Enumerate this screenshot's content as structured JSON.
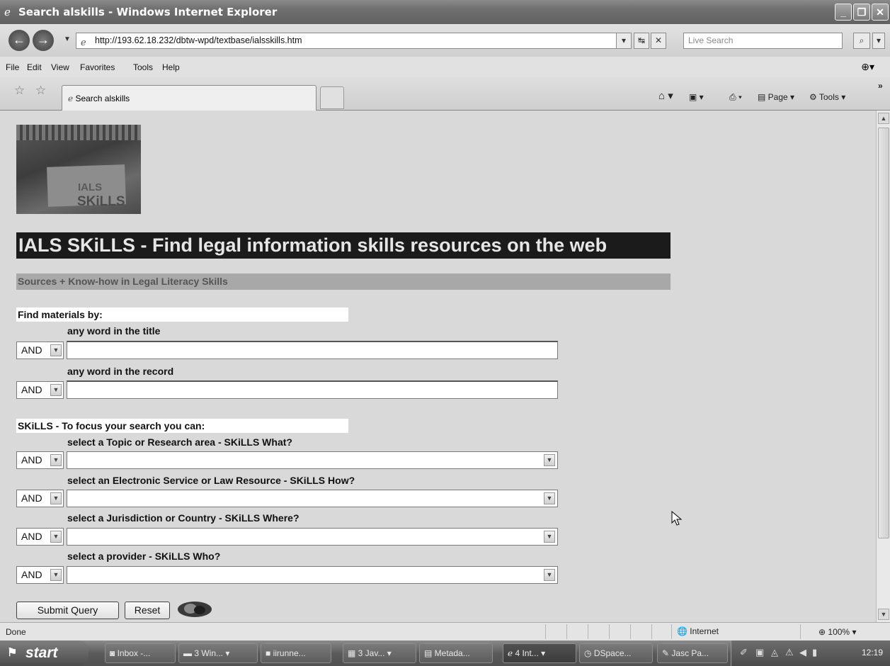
{
  "window": {
    "title": "Search alskills - Windows Internet Explorer"
  },
  "address": {
    "url": "http://193.62.18.232/dbtw-wpd/textbase/ialsskills.htm",
    "search_placeholder": "Live Search"
  },
  "menu": [
    "File",
    "Edit",
    "View",
    "Favorites",
    "Tools",
    "Help"
  ],
  "tab": {
    "label": "Search alskills"
  },
  "commandbar": {
    "page_label": "Page",
    "tools_label": "Tools"
  },
  "page": {
    "logo_line1": "IALS",
    "logo_line2": "SKiLLS",
    "banner": "IALS SKiLLS - Find legal information skills resources on the web",
    "subbanner": "Sources + Know-how in Legal Literacy Skills",
    "find_by": "Find materials by:",
    "field_title_label": "any word in the title",
    "field_record_label": "any word in the record",
    "skills_heading": "SKiLLS - To focus your search you can:",
    "what_label": "select a Topic or Research area - SKiLLS What?",
    "how_label": "select an Electronic Service or Law Resource - SKiLLS How?",
    "where_label": "select a Jurisdiction or Country - SKiLLS Where?",
    "who_label": "select a provider - SKiLLS Who?",
    "bool_value": "AND",
    "submit_label": "Submit Query",
    "reset_label": "Reset"
  },
  "status": {
    "text": "Done",
    "zone": "Internet",
    "zoom": "100%"
  },
  "taskbar": {
    "start": "start",
    "tasks": [
      "Inbox -...",
      "3 Win...",
      "iirunne...",
      "3 Jav...",
      "Metada...",
      "4 Int...",
      "DSpace...",
      "Jasc Pa..."
    ],
    "clock": "12:19"
  }
}
